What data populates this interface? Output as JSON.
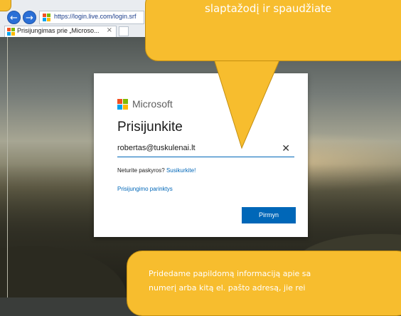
{
  "browser": {
    "url": "https://login.live.com/login.srf",
    "tab_title": "Prisijungimas prie „Microso...",
    "tab_close": "×"
  },
  "card": {
    "brand": "Microsoft",
    "title": "Prisijunkite",
    "email_value": "robertas@tuskulenai.lt",
    "clear_symbol": "✕",
    "no_account_text": "Neturite paskyros?",
    "signup_link": "Susikurkite!",
    "options_link": "Prisijungimo parinktys",
    "next_button": "Pirmyn"
  },
  "callouts": {
    "top_text": "slaptažodį ir spaudžiate",
    "bottom_line1": "Pridedame papildomą informaciją apie sa",
    "bottom_line2": "numerį arba kitą el. pašto adresą, jie rei"
  },
  "colors": {
    "accent": "#0067b8",
    "callout": "#f7bd2e",
    "ms_red": "#f25022",
    "ms_green": "#7fba00",
    "ms_blue": "#00a4ef",
    "ms_yellow": "#ffb900"
  },
  "icons": {
    "back": "back-arrow-icon",
    "forward": "forward-arrow-icon",
    "site": "microsoft-logo-icon",
    "clear": "close-icon"
  }
}
